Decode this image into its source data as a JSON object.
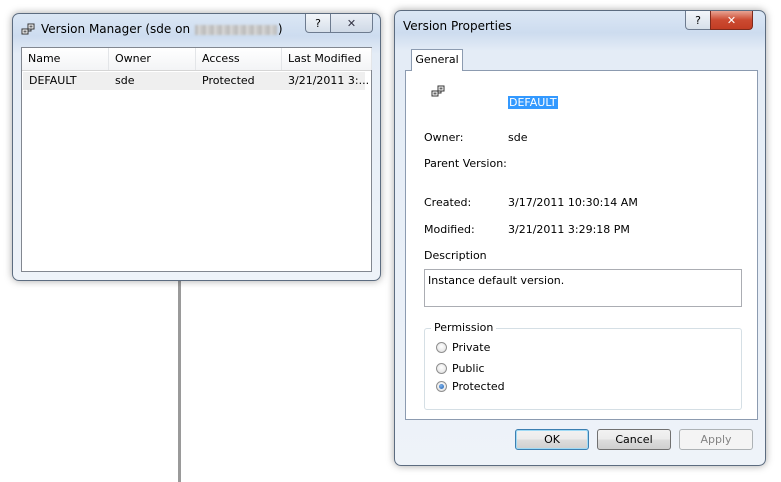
{
  "version_manager": {
    "title_prefix": "Version Manager (sde on",
    "title_suffix": ")",
    "help_label": "?",
    "close_label": "✕",
    "columns": [
      "Name",
      "Owner",
      "Access",
      "Last Modified"
    ],
    "rows": [
      {
        "name": "DEFAULT",
        "owner": "sde",
        "access": "Protected",
        "last_modified": "3/21/2011 3:..."
      }
    ]
  },
  "version_properties": {
    "title": "Version Properties",
    "help_label": "?",
    "close_label": "✕",
    "tab_general": "General",
    "version_name": "DEFAULT",
    "owner_label": "Owner:",
    "owner_value": "sde",
    "parent_label": "Parent Version:",
    "parent_value": "",
    "created_label": "Created:",
    "created_value": "3/17/2011 10:30:14 AM",
    "modified_label": "Modified:",
    "modified_value": "3/21/2011 3:29:18 PM",
    "description_label": "Description",
    "description_value": "Instance default version.",
    "permission_label": "Permission",
    "permissions": [
      "Private",
      "Public",
      "Protected"
    ],
    "permission_selected": "Protected",
    "buttons": {
      "ok": "OK",
      "cancel": "Cancel",
      "apply": "Apply"
    }
  },
  "icons": {
    "app": "versions-icon"
  }
}
